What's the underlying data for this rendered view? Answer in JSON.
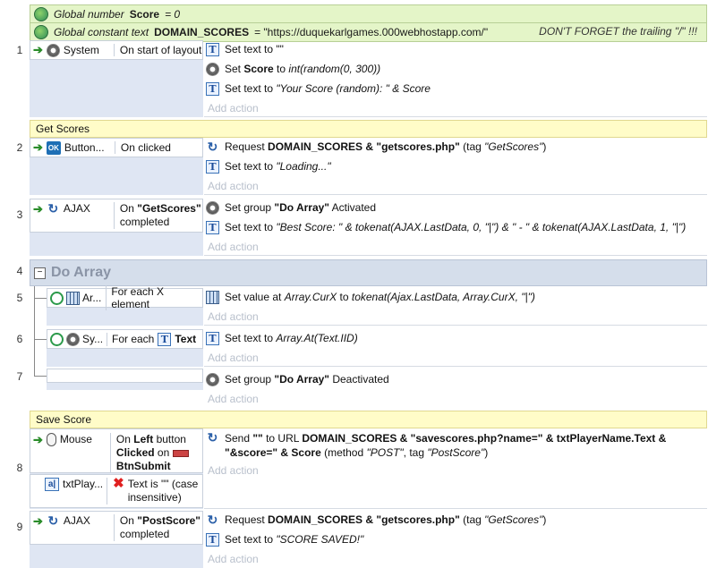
{
  "globals": {
    "g1": {
      "prefix": "Global number",
      "name": "Score",
      "suffix": "= 0"
    },
    "g2": {
      "prefix": "Global constant text",
      "name": "DOMAIN_SCORES",
      "value": "= \"https://duquekarlgames.000webhostapp.com/\"",
      "comment": "DON'T FORGET the trailing \"/\" !!!"
    }
  },
  "add_action": "Add action",
  "groups": {
    "get_scores": "Get Scores",
    "do_array": "Do Array",
    "save_score": "Save Score"
  },
  "events": {
    "e1": {
      "num": "1",
      "object": "System",
      "trigger": "On start of layout",
      "a1": "Set text to \"\"",
      "a2_pre": "Set ",
      "a2_bold": "Score",
      "a2_post": " to ",
      "a2_it": "int(random(0, 300))",
      "a3_pre": "Set text to ",
      "a3_it": "\"Your Score (random): \" & Score"
    },
    "e2": {
      "num": "2",
      "object": "Button...",
      "trigger": "On clicked",
      "a1_pre": "Request ",
      "a1_bold": "DOMAIN_SCORES & \"getscores.php\"",
      "a1_post": " (tag ",
      "a1_it": "\"GetScores\"",
      "a1_end": ")",
      "a2_pre": "Set text to ",
      "a2_it": "\"Loading...\""
    },
    "e3": {
      "num": "3",
      "object": "AJAX",
      "trigger_pre": "On ",
      "trigger_bold": "\"GetScores\"",
      "trigger_post": "completed",
      "a1_pre": "Set group ",
      "a1_bold": "\"Do Array\"",
      "a1_post": " Activated",
      "a2_pre": "Set text to ",
      "a2_it": "\"Best Score: \" & tokenat(AJAX.LastData, 0, \"|\") & \" - \" & tokenat(AJAX.LastData, 1, \"|\")"
    },
    "e4": {
      "num": "4"
    },
    "e5": {
      "num": "5",
      "object": "Ar...",
      "trigger": "For each X element",
      "a1_pre": "Set value at ",
      "a1_it": "Array.CurX",
      "a1_mid": " to ",
      "a1_it2": "tokenat(Ajax.LastData, Array.CurX, \"|\")"
    },
    "e6": {
      "num": "6",
      "object": "Sy...",
      "trigger": "For each",
      "trigger_obj": "Text",
      "a1_pre": "Set text to ",
      "a1_it": "Array.At(Text.IID)"
    },
    "e7": {
      "num": "7",
      "a1_pre": "Set group ",
      "a1_bold": "\"Do Array\"",
      "a1_post": " Deactivated"
    },
    "e8": {
      "num": "8",
      "object": "Mouse",
      "trigger_pre": "On ",
      "trigger_left": "Left",
      "trigger_mid": " button",
      "trigger_clicked": "Clicked",
      "trigger_on": " on ",
      "trigger_btn": "BtnSubmit",
      "c2_object": "txtPlay...",
      "c2_text": "Text is \"\" (case insensitive)",
      "a1_pre": "Send ",
      "a1_q": "\"\"",
      "a1_to": " to URL ",
      "a1_b1": "DOMAIN_SCORES & \"savescores.php?name=\" & txtPlayerName.Text &",
      "a1_b2": "\"&score=\" & Score",
      "a1_meth": " (method ",
      "a1_post": "\"POST\"",
      "a1_tag": ", tag ",
      "a1_tagv": "\"PostScore\"",
      "a1_end": ")"
    },
    "e9": {
      "num": "9",
      "object": "AJAX",
      "trigger_pre": "On ",
      "trigger_bold": "\"PostScore\"",
      "trigger_post": "completed",
      "a1_pre": "Request ",
      "a1_bold": "DOMAIN_SCORES & \"getscores.php\"",
      "a1_post": " (tag ",
      "a1_it": "\"GetScores\"",
      "a1_end": ")",
      "a2_pre": "Set text to ",
      "a2_it": "\"SCORE SAVED!\""
    }
  }
}
